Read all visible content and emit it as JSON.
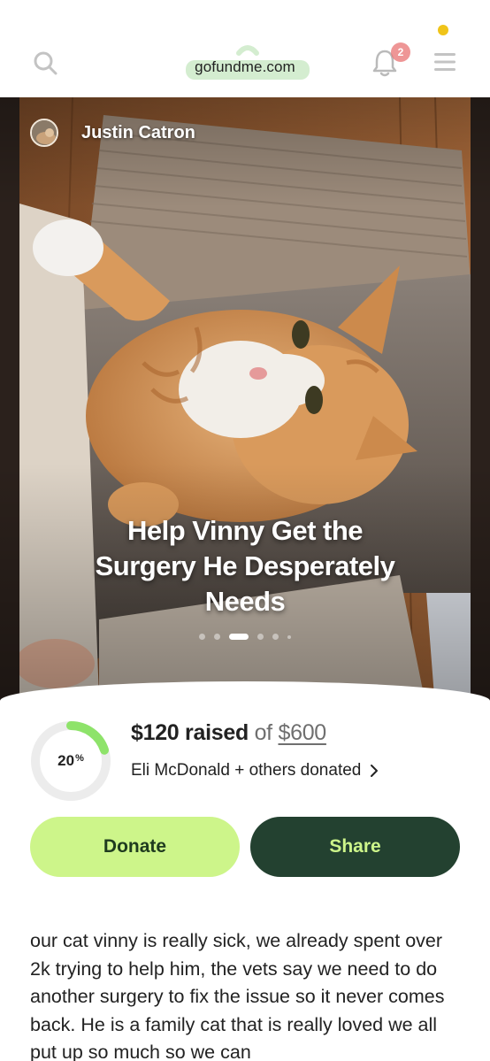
{
  "browser": {
    "url": "gofundme.com",
    "notification_count": "2",
    "icons": [
      "search-icon",
      "bell-icon",
      "menu-icon"
    ]
  },
  "campaign": {
    "organizer": "Justin Catron",
    "title": "Help Vinny Get the Surgery He Desperately Needs",
    "carousel": {
      "total": 6,
      "active": 3
    }
  },
  "progress": {
    "percent_label": "20",
    "percent_suffix": "%",
    "percent": 20,
    "raised": "$120 raised",
    "of": "of",
    "goal": "$600",
    "donors_text": "Eli McDonald + others donated"
  },
  "actions": {
    "donate_label": "Donate",
    "share_label": "Share"
  },
  "story": {
    "text": "our cat vinny is really sick, we already spent over 2k trying to help him, the vets say we need to do another surgery to fix the issue so it never comes back. He is a family cat that is really loved we all put up so much so we can"
  },
  "colors": {
    "accent_light": "#cdf58a",
    "accent_dark": "#234130",
    "ring_track": "#ececec",
    "ring_fill": "#8ee36a",
    "status_dot": "#f0c419"
  }
}
